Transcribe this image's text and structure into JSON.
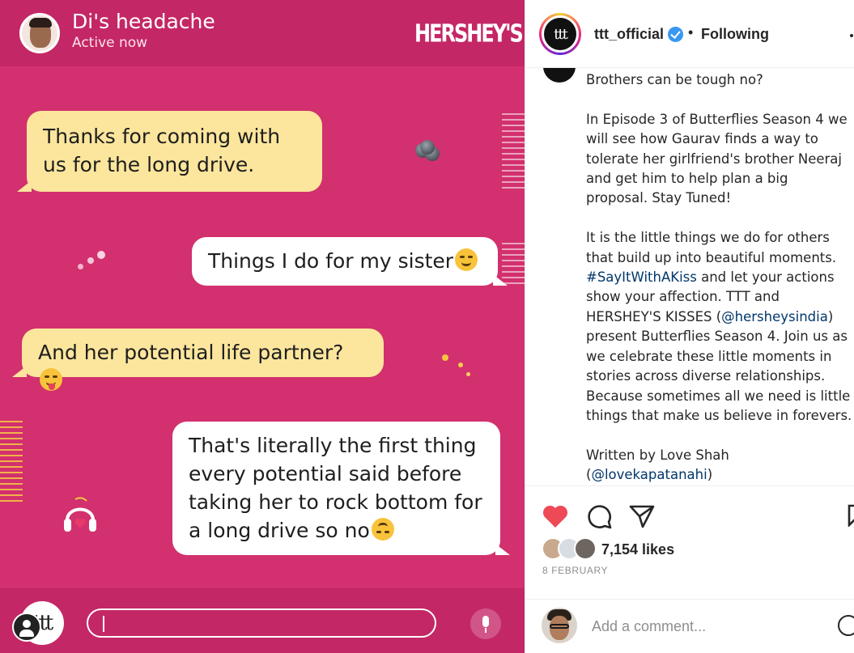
{
  "story": {
    "contact_name": "Di's headache",
    "contact_status": "Active now",
    "brand": "HERSHEY'S",
    "messages": [
      {
        "text": "Thanks for coming with us for the long drive.",
        "sender": "other"
      },
      {
        "text": "Things I do for my sister",
        "sender": "self",
        "emoji": "smirk-emoji"
      },
      {
        "text": "And her potential life partner?",
        "sender": "other",
        "emoji": "tongue-emoji"
      },
      {
        "text": "That's literally the first thing every potential said before taking her to rock bottom for a long drive so no",
        "sender": "self",
        "emoji": "upside-down-emoji"
      }
    ],
    "compose_logo": "ttt"
  },
  "post": {
    "header": {
      "avatar_text": "ttt",
      "username": "ttt_official",
      "separator": "•",
      "follow_status": "Following"
    },
    "caption": {
      "p1": "Brothers can be tough no?",
      "p2": "In Episode 3 of Butterflies Season 4 we will see how Gaurav finds a way to tolerate her girlfriend's brother Neeraj and get him to help plan a big proposal. Stay Tuned!",
      "p3_a": "It is the little things we do for others that build up into beautiful moments. ",
      "p3_hashtag": "#SayItWithAKiss",
      "p3_b": " and let your actions show your affection. TTT and HERSHEY'S KISSES (",
      "p3_mention": "@hersheysindia",
      "p3_c": ") present Butterflies Season 4. Join us as we celebrate these little moments in stories across diverse relationships. Because sometimes all we need is little things that make us believe in forevers.",
      "p4_a": "Written by Love Shah",
      "p4_b": "(",
      "p4_mention": "@lovekapatanahi",
      "p4_c": ")"
    },
    "likes": "7,154 likes",
    "date": "8 FEBRUARY",
    "comment_placeholder": "Add a comment...",
    "colors": {
      "like": "#ed4956",
      "link": "#00376b",
      "verified": "#3897f0",
      "story_bg": "#d2306e",
      "bubble_yellow": "#fce69d"
    }
  }
}
